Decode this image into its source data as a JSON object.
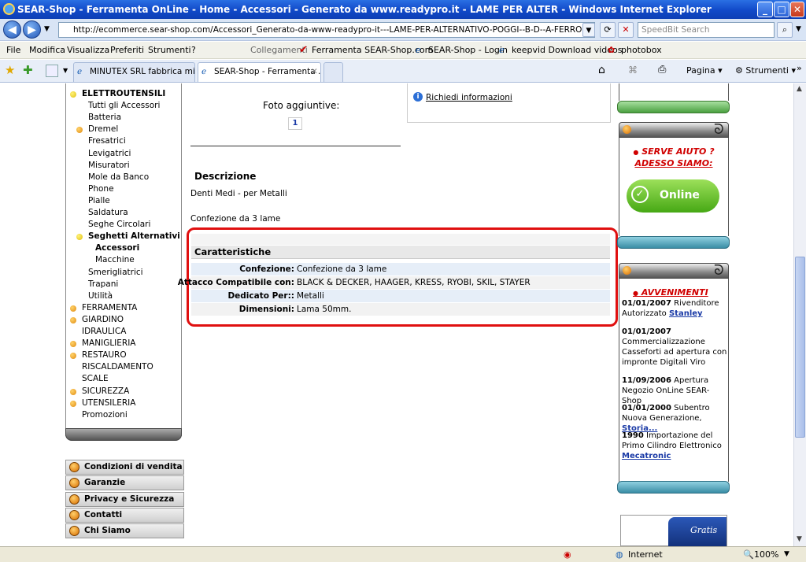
{
  "window": {
    "title": "SEAR-Shop - Ferramenta OnLine - Home - Accessori - Generato da www.readypro.it - LAME PER ALTER - Windows Internet Explorer"
  },
  "address_bar": {
    "url": "http://ecommerce.sear-shop.com/Accessori_Generato-da-www-readypro-it---LAME-PER-ALTERNATIVO-POGGI--B-D--A-FERRO-685-00.1.19.136.gp.11",
    "search_placeholder": "SpeedBit Search"
  },
  "menu": {
    "items": [
      "File",
      "Modifica",
      "Visualizza",
      "Preferiti",
      "Strumenti",
      "?"
    ],
    "links_label": "Collegamenti",
    "links": [
      "Ferramenta SEAR-Shop.com",
      "SEAR-Shop - Login",
      "keepvid Download videos",
      "photobox"
    ]
  },
  "tabs": [
    {
      "label": "MINUTEX SRL fabbrica minut..."
    },
    {
      "label": "SEAR-Shop - Ferramenta ..."
    }
  ],
  "toolbar": {
    "page": "Pagina",
    "tools": "Strumenti"
  },
  "sidebar": {
    "categories": [
      {
        "label": "ELETTROUTENSILI",
        "level": 0,
        "bullet": "yellow",
        "bold": true
      },
      {
        "label": "Tutti gli Accessori",
        "level": 1
      },
      {
        "label": "Batteria",
        "level": 1
      },
      {
        "label": "Dremel",
        "level": 1,
        "bullet": "orange"
      },
      {
        "label": "Fresatrici",
        "level": 1
      },
      {
        "label": "Levigatrici",
        "level": 1
      },
      {
        "label": "Misuratori",
        "level": 1
      },
      {
        "label": "Mole da Banco",
        "level": 1
      },
      {
        "label": "Phone",
        "level": 1
      },
      {
        "label": "Pialle",
        "level": 1
      },
      {
        "label": "Saldatura",
        "level": 1
      },
      {
        "label": "Seghe Circolari",
        "level": 1
      },
      {
        "label": "Seghetti Alternativi",
        "level": 1,
        "bullet": "yellow",
        "bold": true
      },
      {
        "label": "Accessori",
        "level": 2,
        "bold": true
      },
      {
        "label": "Macchine",
        "level": 2
      },
      {
        "label": "Smerigliatrici",
        "level": 1
      },
      {
        "label": "Trapani",
        "level": 1
      },
      {
        "label": "Utilità",
        "level": 1
      },
      {
        "label": "FERRAMENTA",
        "level": 0,
        "bullet": "orange"
      },
      {
        "label": "GIARDINO",
        "level": 0,
        "bullet": "orange"
      },
      {
        "label": "IDRAULICA",
        "level": 0
      },
      {
        "label": "MANIGLIERIA",
        "level": 0,
        "bullet": "orange"
      },
      {
        "label": "RESTAURO",
        "level": 0,
        "bullet": "orange"
      },
      {
        "label": "RISCALDAMENTO",
        "level": 0
      },
      {
        "label": "SCALE",
        "level": 0
      },
      {
        "label": "SICUREZZA",
        "level": 0,
        "bullet": "orange"
      },
      {
        "label": "UTENSILERIA",
        "level": 0,
        "bullet": "orange"
      },
      {
        "label": "Promozioni",
        "level": 0
      }
    ],
    "buttons": [
      "Condizioni di vendita",
      "Garanzie",
      "Privacy e Sicurezza",
      "Contatti",
      "Chi Siamo"
    ]
  },
  "product": {
    "extra_photos_label": "Foto aggiuntive:",
    "photo_page": "1",
    "info_link": "Richiedi informazioni",
    "description_title": "Descrizione",
    "description_lines": [
      "Denti Medi - per Metalli",
      "Confezione da 3 lame"
    ],
    "features_title": "Caratteristiche",
    "features": [
      {
        "key": "Confezione:",
        "value": "Confezione da 3 lame"
      },
      {
        "key": "Attacco Compatibile con:",
        "value": "BLACK & DECKER, HAAGER, KRESS, RYOBI, SKIL, STAYER"
      },
      {
        "key": "Dedicato Per::",
        "value": "Metalli"
      },
      {
        "key": "Dimensioni:",
        "value": "Lama 50mm."
      }
    ]
  },
  "right": {
    "help_line1": "SERVE AIUTO ?",
    "help_line2": "ADESSO SIAMO:",
    "online_label": "Online",
    "events_title": "AVVENIMENTI",
    "events": [
      {
        "date": "01/01/2007",
        "text": "Rivenditore Autorizzato",
        "link": "Stanley"
      },
      {
        "date": "01/01/2007",
        "text": "Commercializzazione Casseforti ad apertura con impronte Digitali Viro",
        "link": ""
      },
      {
        "date": "11/09/2006",
        "text": "Apertura Negozio OnLine SEAR-Shop",
        "link": ""
      },
      {
        "date": "01/01/2000",
        "text": "Subentro Nuova Generazione,",
        "link": "Storia..."
      },
      {
        "date": "1990",
        "text": "Importazione del Primo Cilindro Elettronico",
        "link": "Mecatronic"
      }
    ],
    "gratis_label": "Gratis"
  },
  "status": {
    "zone": "Internet",
    "zoom": "100%"
  }
}
